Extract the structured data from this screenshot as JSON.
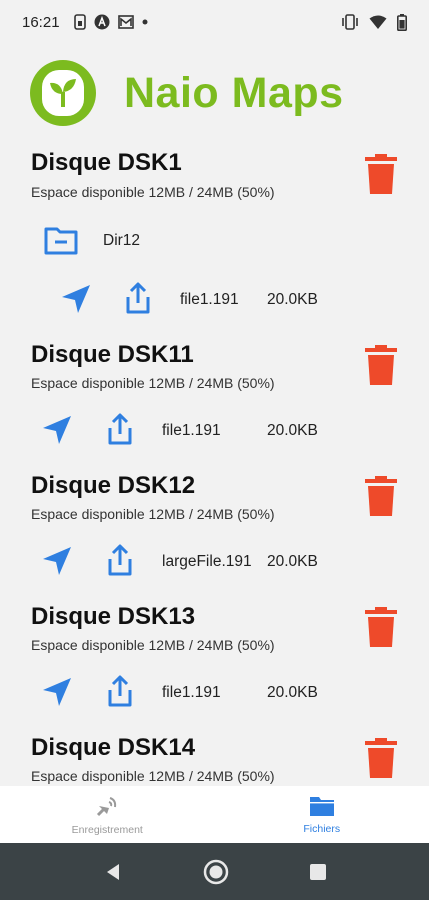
{
  "status_bar": {
    "time": "16:21"
  },
  "header": {
    "title": "Naio Maps"
  },
  "disks": [
    {
      "title": "Disque DSK1",
      "space": "Espace disponible 12MB / 24MB (50%)",
      "dir": "Dir12",
      "file": {
        "name": "file1.191",
        "size": "20.0KB"
      }
    },
    {
      "title": "Disque DSK11",
      "space": "Espace disponible 12MB / 24MB (50%)",
      "file": {
        "name": "file1.191",
        "size": "20.0KB"
      }
    },
    {
      "title": "Disque DSK12",
      "space": "Espace disponible 12MB / 24MB (50%)",
      "file": {
        "name": "largeFile.191",
        "size": "20.0KB"
      }
    },
    {
      "title": "Disque DSK13",
      "space": "Espace disponible 12MB / 24MB (50%)",
      "file": {
        "name": "file1.191",
        "size": "20.0KB"
      }
    },
    {
      "title": "Disque DSK14",
      "space": "Espace disponible 12MB / 24MB (50%)"
    }
  ],
  "bottom_nav": {
    "recording": "Enregistrement",
    "files": "Fichiers"
  },
  "colors": {
    "brand_green": "#7cbb1f",
    "accent_blue": "#2f7fe0",
    "delete_red": "#ee4a2a"
  }
}
